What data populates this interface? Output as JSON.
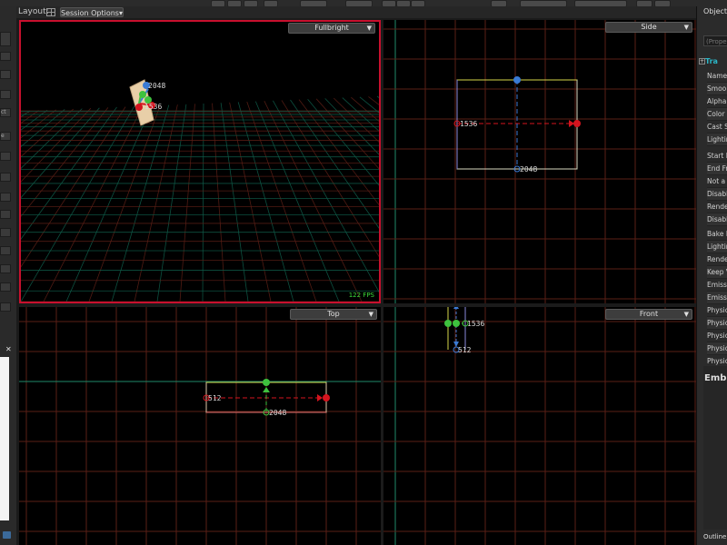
{
  "toolbar": {
    "layout_label": "Layout:",
    "session_options": "Session Options▾"
  },
  "left_panel": {
    "items": [
      "",
      "",
      "",
      "",
      "ct",
      "e",
      "",
      "",
      "",
      "",
      "",
      "",
      "",
      "",
      ""
    ],
    "close_glyph": "✕"
  },
  "viewports": {
    "perspective": {
      "mode": "Fullbright",
      "fps": "122 FPS",
      "gizmo_labels": [
        "2048",
        "1536"
      ]
    },
    "side": {
      "mode": "Side",
      "gizmo_labels": [
        "1536",
        "2048"
      ]
    },
    "top": {
      "mode": "Top",
      "gizmo_labels": [
        "512",
        "2048"
      ]
    },
    "front": {
      "mode": "Front",
      "gizmo_labels": [
        "1536",
        "512"
      ]
    }
  },
  "right_panel": {
    "title": "Object P",
    "search_placeholder": "(Proper",
    "section_icon": "+",
    "section_label": "Tra",
    "properties": [
      "Name",
      "Smoo",
      "Alpha",
      "Color",
      "Cast S",
      "Lightin",
      "Start F",
      "End Fr",
      "Not a",
      "Disabl",
      "Rende",
      "Disabl",
      "Bake L",
      "Lightin",
      "Rende",
      "Keep V",
      "Emissi",
      "Emissi",
      "Physic",
      "Physic",
      "Physic",
      "Physic",
      "Physic"
    ],
    "embed_label": "Emb",
    "outline_label": "Outline"
  },
  "colors": {
    "viewport_active_border": "#c8102e",
    "grid_red": "#5a1f16",
    "grid_green": "#0f5a48",
    "gizmo_red": "#d4141e",
    "gizmo_green": "#3ec13e",
    "gizmo_blue": "#3a7ad4",
    "fps_text": "#3adb3a",
    "section_teal": "#2bb7c8"
  },
  "icons": {
    "layout_grid": "layout-grid-icon",
    "dropdown": "chevron-down-icon",
    "close": "close-icon"
  }
}
